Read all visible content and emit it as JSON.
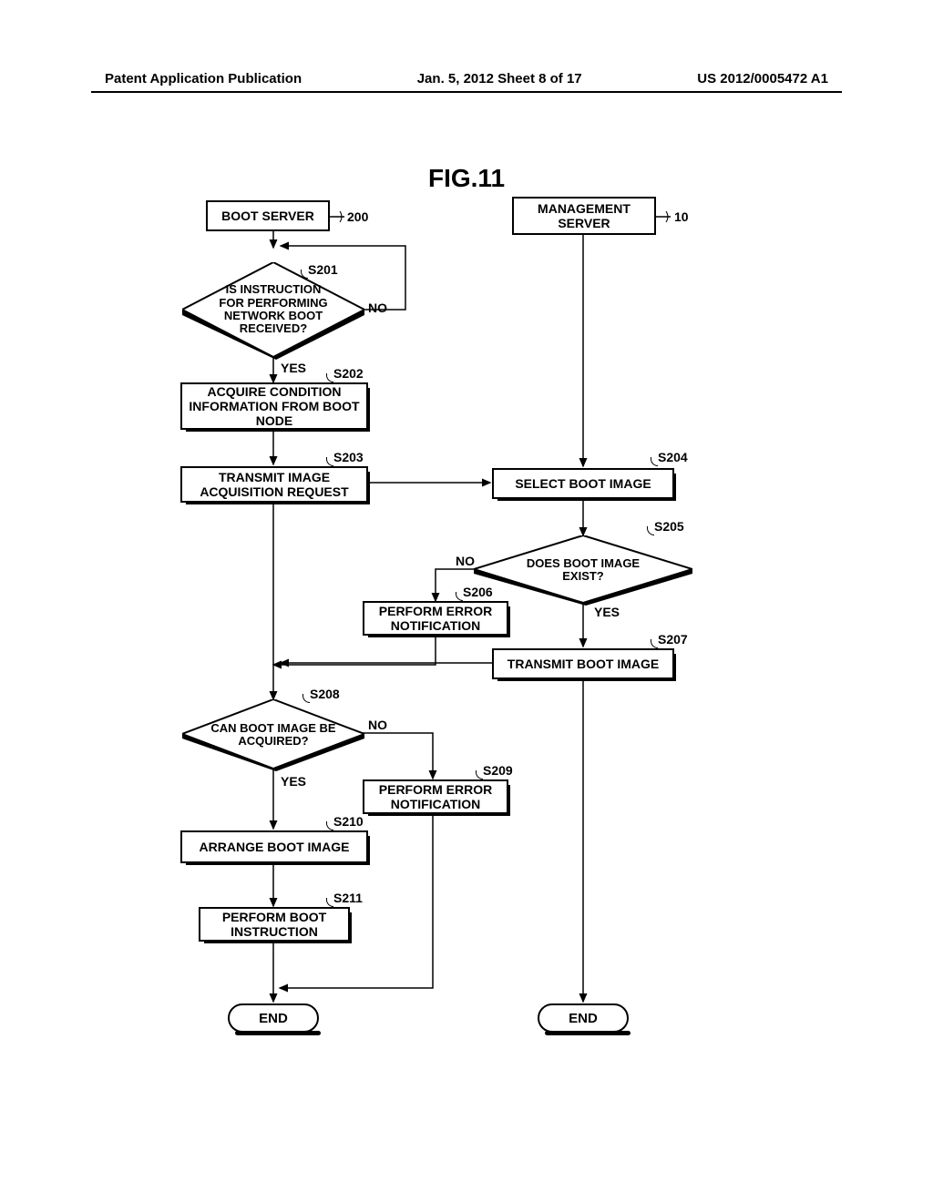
{
  "header": {
    "left": "Patent Application Publication",
    "center": "Jan. 5, 2012   Sheet 8 of 17",
    "right": "US 2012/0005472 A1"
  },
  "figure_title": "FIG.11",
  "nodes": {
    "boot_server": "BOOT SERVER",
    "mgmt_server": "MANAGEMENT\nSERVER",
    "s201_q": "IS INSTRUCTION\nFOR PERFORMING\nNETWORK BOOT\nRECEIVED?",
    "s202": "ACQUIRE CONDITION\nINFORMATION FROM BOOT\nNODE",
    "s203": "TRANSMIT IMAGE\nACQUISITION REQUEST",
    "s204": "SELECT BOOT IMAGE",
    "s205_q": "DOES BOOT IMAGE\nEXIST?",
    "s206": "PERFORM ERROR\nNOTIFICATION",
    "s207": "TRANSMIT BOOT IMAGE",
    "s208_q": "CAN BOOT IMAGE BE\nACQUIRED?",
    "s209": "PERFORM ERROR\nNOTIFICATION",
    "s210": "ARRANGE BOOT IMAGE",
    "s211": "PERFORM BOOT\nINSTRUCTION",
    "end": "END"
  },
  "refs": {
    "r200": "200",
    "r10": "10",
    "s201": "S201",
    "s202": "S202",
    "s203": "S203",
    "s204": "S204",
    "s205": "S205",
    "s206": "S206",
    "s207": "S207",
    "s208": "S208",
    "s209": "S209",
    "s210": "S210",
    "s211": "S211"
  },
  "branch": {
    "yes": "YES",
    "no": "NO"
  },
  "chart_data": {
    "type": "flowchart",
    "lanes": [
      {
        "id": "boot_server",
        "label": "BOOT SERVER",
        "ref": "200"
      },
      {
        "id": "mgmt_server",
        "label": "MANAGEMENT SERVER",
        "ref": "10"
      }
    ],
    "nodes": [
      {
        "id": "S201",
        "lane": "boot_server",
        "type": "decision",
        "text": "IS INSTRUCTION FOR PERFORMING NETWORK BOOT RECEIVED?"
      },
      {
        "id": "S202",
        "lane": "boot_server",
        "type": "process",
        "text": "ACQUIRE CONDITION INFORMATION FROM BOOT NODE"
      },
      {
        "id": "S203",
        "lane": "boot_server",
        "type": "process",
        "text": "TRANSMIT IMAGE ACQUISITION REQUEST"
      },
      {
        "id": "S204",
        "lane": "mgmt_server",
        "type": "process",
        "text": "SELECT BOOT IMAGE"
      },
      {
        "id": "S205",
        "lane": "mgmt_server",
        "type": "decision",
        "text": "DOES BOOT IMAGE EXIST?"
      },
      {
        "id": "S206",
        "lane": "mgmt_server",
        "type": "process",
        "text": "PERFORM ERROR NOTIFICATION"
      },
      {
        "id": "S207",
        "lane": "mgmt_server",
        "type": "process",
        "text": "TRANSMIT BOOT IMAGE"
      },
      {
        "id": "S208",
        "lane": "boot_server",
        "type": "decision",
        "text": "CAN BOOT IMAGE BE ACQUIRED?"
      },
      {
        "id": "S209",
        "lane": "boot_server",
        "type": "process",
        "text": "PERFORM ERROR NOTIFICATION"
      },
      {
        "id": "S210",
        "lane": "boot_server",
        "type": "process",
        "text": "ARRANGE BOOT IMAGE"
      },
      {
        "id": "S211",
        "lane": "boot_server",
        "type": "process",
        "text": "PERFORM BOOT INSTRUCTION"
      },
      {
        "id": "END1",
        "lane": "boot_server",
        "type": "terminator",
        "text": "END"
      },
      {
        "id": "END2",
        "lane": "mgmt_server",
        "type": "terminator",
        "text": "END"
      }
    ],
    "edges": [
      {
        "from": "boot_server",
        "to": "S201"
      },
      {
        "from": "S201",
        "to": "S202",
        "label": "YES"
      },
      {
        "from": "S201",
        "to": "boot_server_loop",
        "label": "NO"
      },
      {
        "from": "S202",
        "to": "S203"
      },
      {
        "from": "S203",
        "to": "S204"
      },
      {
        "from": "S204",
        "to": "S205"
      },
      {
        "from": "S205",
        "to": "S207",
        "label": "YES"
      },
      {
        "from": "S205",
        "to": "S206",
        "label": "NO"
      },
      {
        "from": "S206",
        "to": "S208"
      },
      {
        "from": "S207",
        "to": "S208"
      },
      {
        "from": "S208",
        "to": "S210",
        "label": "YES"
      },
      {
        "from": "S208",
        "to": "S209",
        "label": "NO"
      },
      {
        "from": "S209",
        "to": "END1"
      },
      {
        "from": "S210",
        "to": "S211"
      },
      {
        "from": "S211",
        "to": "END1"
      },
      {
        "from": "S207",
        "to": "END2"
      }
    ]
  }
}
